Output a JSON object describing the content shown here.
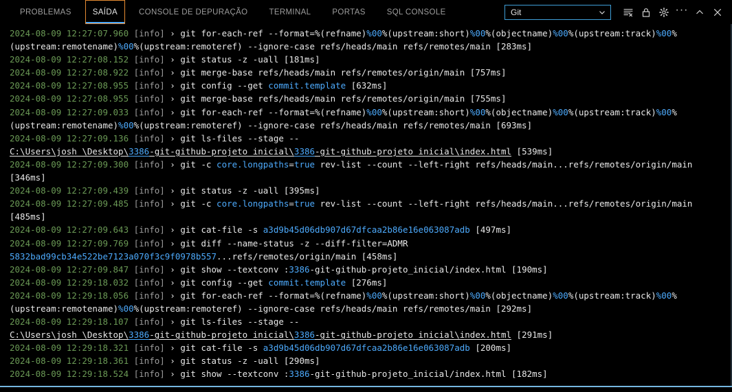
{
  "panel": {
    "tabs": [
      {
        "label": "PROBLEMAS",
        "id": "problemas",
        "active": false
      },
      {
        "label": "SAÍDA",
        "id": "saida",
        "active": true
      },
      {
        "label": "CONSOLE DE DEPURAÇÃO",
        "id": "console-depuracao",
        "active": false
      },
      {
        "label": "TERMINAL",
        "id": "terminal",
        "active": false
      },
      {
        "label": "PORTAS",
        "id": "portas",
        "active": false
      },
      {
        "label": "SQL CONSOLE",
        "id": "sql-console",
        "active": false
      }
    ],
    "channel_select": {
      "value": "Git",
      "icon": "chevron-down-icon"
    },
    "actions": [
      {
        "name": "clear-output-button",
        "icon": "clear-output-icon"
      },
      {
        "name": "lock-scroll-button",
        "icon": "lock-icon"
      },
      {
        "name": "settings-button",
        "icon": "gear-icon"
      },
      {
        "name": "more-actions-button",
        "icon": "ellipsis-icon",
        "glyph": "···"
      },
      {
        "name": "maximize-panel-button",
        "icon": "chevron-up-icon"
      },
      {
        "name": "close-panel-button",
        "icon": "close-icon"
      }
    ]
  },
  "colors": {
    "background": "#000000",
    "text": "#e8e8e8",
    "timestamp": "#6a9955",
    "info": "#9d9d9d",
    "link": "#4daafc",
    "active_tab_underline": "#4daafc",
    "focus_border": "#e78c32",
    "select_border": "#3f9fd8",
    "status_accent": "#75b6e0"
  },
  "output": {
    "lines": [
      {
        "ts": "2024-08-09 12:27:07.960",
        "level": "[info]",
        "parts": [
          {
            "t": "cmd",
            "v": "git for-each-ref --format=%(refname)"
          },
          {
            "t": "lnk",
            "v": "%00"
          },
          {
            "t": "cmd",
            "v": "%(upstream:short)"
          },
          {
            "t": "lnk",
            "v": "%00"
          },
          {
            "t": "cmd",
            "v": "%(objectname)"
          },
          {
            "t": "lnk",
            "v": "%00"
          },
          {
            "t": "cmd",
            "v": "%(upstream:track)"
          },
          {
            "t": "lnk",
            "v": "%00"
          },
          {
            "t": "cmd",
            "v": "%(upstream:remotename)"
          },
          {
            "t": "lnk",
            "v": "%00"
          },
          {
            "t": "cmd",
            "v": "%(upstream:remoteref) --ignore-case refs/heads/main refs/remotes/main [283ms]"
          }
        ]
      },
      {
        "ts": "2024-08-09 12:27:08.152",
        "level": "[info]",
        "parts": [
          {
            "t": "cmd",
            "v": "git status -z -uall [181ms]"
          }
        ]
      },
      {
        "ts": "2024-08-09 12:27:08.922",
        "level": "[info]",
        "parts": [
          {
            "t": "cmd",
            "v": "git merge-base refs/heads/main refs/remotes/origin/main [757ms]"
          }
        ]
      },
      {
        "ts": "2024-08-09 12:27:08.955",
        "level": "[info]",
        "parts": [
          {
            "t": "cmd",
            "v": "git config --get "
          },
          {
            "t": "lnk",
            "v": "commit.template"
          },
          {
            "t": "cmd",
            "v": " [632ms]"
          }
        ]
      },
      {
        "ts": "2024-08-09 12:27:08.955",
        "level": "[info]",
        "parts": [
          {
            "t": "cmd",
            "v": "git merge-base refs/heads/main refs/remotes/origin/main [755ms]"
          }
        ]
      },
      {
        "ts": "2024-08-09 12:27:09.033",
        "level": "[info]",
        "parts": [
          {
            "t": "cmd",
            "v": "git for-each-ref --format=%(refname)"
          },
          {
            "t": "lnk",
            "v": "%00"
          },
          {
            "t": "cmd",
            "v": "%(upstream:short)"
          },
          {
            "t": "lnk",
            "v": "%00"
          },
          {
            "t": "cmd",
            "v": "%(objectname)"
          },
          {
            "t": "lnk",
            "v": "%00"
          },
          {
            "t": "cmd",
            "v": "%(upstream:track)"
          },
          {
            "t": "lnk",
            "v": "%00"
          },
          {
            "t": "cmd",
            "v": "%(upstream:remotename)"
          },
          {
            "t": "lnk",
            "v": "%00"
          },
          {
            "t": "cmd",
            "v": "%(upstream:remoteref) --ignore-case refs/heads/main refs/remotes/main [693ms]"
          }
        ]
      },
      {
        "ts": "2024-08-09 12:27:09.136",
        "level": "[info]",
        "parts": [
          {
            "t": "cmd",
            "v": "git ls-files --stage -- "
          }
        ]
      },
      {
        "ts": null,
        "level": null,
        "parts": [
          {
            "t": "pathstart",
            "v": "C:\\Users\\josh_\\Desktop\\"
          },
          {
            "t": "pathseg",
            "v": "3386"
          },
          {
            "t": "pathmid",
            "v": "-git-github-projeto_inicial\\"
          },
          {
            "t": "pathseg",
            "v": "3386"
          },
          {
            "t": "pathend",
            "v": "-git-github-projeto_inicial\\index.html"
          },
          {
            "t": "cmd",
            "v": " [539ms]"
          }
        ]
      },
      {
        "ts": "2024-08-09 12:27:09.300",
        "level": "[info]",
        "parts": [
          {
            "t": "cmd",
            "v": "git -c "
          },
          {
            "t": "lnk",
            "v": "core.longpaths"
          },
          {
            "t": "cmd",
            "v": "="
          },
          {
            "t": "lnk",
            "v": "true"
          },
          {
            "t": "cmd",
            "v": " rev-list --count --left-right refs/heads/main...refs/remotes/origin/main [346ms]"
          }
        ]
      },
      {
        "ts": "2024-08-09 12:27:09.439",
        "level": "[info]",
        "parts": [
          {
            "t": "cmd",
            "v": "git status -z -uall [395ms]"
          }
        ]
      },
      {
        "ts": "2024-08-09 12:27:09.485",
        "level": "[info]",
        "parts": [
          {
            "t": "cmd",
            "v": "git -c "
          },
          {
            "t": "lnk",
            "v": "core.longpaths"
          },
          {
            "t": "cmd",
            "v": "="
          },
          {
            "t": "lnk",
            "v": "true"
          },
          {
            "t": "cmd",
            "v": " rev-list --count --left-right refs/heads/main...refs/remotes/origin/main [485ms]"
          }
        ]
      },
      {
        "ts": "2024-08-09 12:27:09.643",
        "level": "[info]",
        "parts": [
          {
            "t": "cmd",
            "v": "git cat-file -s "
          },
          {
            "t": "lnk",
            "v": "a3d9b45d06db907d67dfcaa2b86e16e063087adb"
          },
          {
            "t": "cmd",
            "v": " [497ms]"
          }
        ]
      },
      {
        "ts": "2024-08-09 12:27:09.769",
        "level": "[info]",
        "parts": [
          {
            "t": "cmd",
            "v": "git diff --name-status -z --diff-filter=ADMR "
          },
          {
            "t": "lnk",
            "v": "5832bad99cb34e522be7123a070f3c9f0978b557"
          },
          {
            "t": "cmd",
            "v": "...refs/remotes/origin/main [458ms]"
          }
        ]
      },
      {
        "ts": "2024-08-09 12:27:09.847",
        "level": "[info]",
        "parts": [
          {
            "t": "cmd",
            "v": "git show --textconv :"
          },
          {
            "t": "lnk",
            "v": "3386"
          },
          {
            "t": "cmd",
            "v": "-git-github-projeto_inicial/index.html [190ms]"
          }
        ]
      },
      {
        "ts": "2024-08-09 12:29:18.032",
        "level": "[info]",
        "parts": [
          {
            "t": "cmd",
            "v": "git config --get "
          },
          {
            "t": "lnk",
            "v": "commit.template"
          },
          {
            "t": "cmd",
            "v": " [276ms]"
          }
        ]
      },
      {
        "ts": "2024-08-09 12:29:18.056",
        "level": "[info]",
        "parts": [
          {
            "t": "cmd",
            "v": "git for-each-ref --format=%(refname)"
          },
          {
            "t": "lnk",
            "v": "%00"
          },
          {
            "t": "cmd",
            "v": "%(upstream:short)"
          },
          {
            "t": "lnk",
            "v": "%00"
          },
          {
            "t": "cmd",
            "v": "%(objectname)"
          },
          {
            "t": "lnk",
            "v": "%00"
          },
          {
            "t": "cmd",
            "v": "%(upstream:track)"
          },
          {
            "t": "lnk",
            "v": "%00"
          },
          {
            "t": "cmd",
            "v": "%(upstream:remotename)"
          },
          {
            "t": "lnk",
            "v": "%00"
          },
          {
            "t": "cmd",
            "v": "%(upstream:remoteref) --ignore-case refs/heads/main refs/remotes/main [292ms]"
          }
        ]
      },
      {
        "ts": "2024-08-09 12:29:18.107",
        "level": "[info]",
        "parts": [
          {
            "t": "cmd",
            "v": "git ls-files --stage -- "
          }
        ]
      },
      {
        "ts": null,
        "level": null,
        "parts": [
          {
            "t": "pathstart",
            "v": "C:\\Users\\josh_\\Desktop\\"
          },
          {
            "t": "pathseg",
            "v": "3386"
          },
          {
            "t": "pathmid",
            "v": "-git-github-projeto_inicial\\"
          },
          {
            "t": "pathseg",
            "v": "3386"
          },
          {
            "t": "pathend",
            "v": "-git-github-projeto_inicial\\index.html"
          },
          {
            "t": "cmd",
            "v": " [291ms]"
          }
        ]
      },
      {
        "ts": "2024-08-09 12:29:18.321",
        "level": "[info]",
        "parts": [
          {
            "t": "cmd",
            "v": "git cat-file -s "
          },
          {
            "t": "lnk",
            "v": "a3d9b45d06db907d67dfcaa2b86e16e063087adb"
          },
          {
            "t": "cmd",
            "v": " [200ms]"
          }
        ]
      },
      {
        "ts": "2024-08-09 12:29:18.361",
        "level": "[info]",
        "parts": [
          {
            "t": "cmd",
            "v": "git status -z -uall [290ms]"
          }
        ]
      },
      {
        "ts": "2024-08-09 12:29:18.524",
        "level": "[info]",
        "parts": [
          {
            "t": "cmd",
            "v": "git show --textconv :"
          },
          {
            "t": "lnk",
            "v": "3386"
          },
          {
            "t": "cmd",
            "v": "-git-github-projeto_inicial/index.html [182ms]"
          }
        ]
      }
    ]
  }
}
